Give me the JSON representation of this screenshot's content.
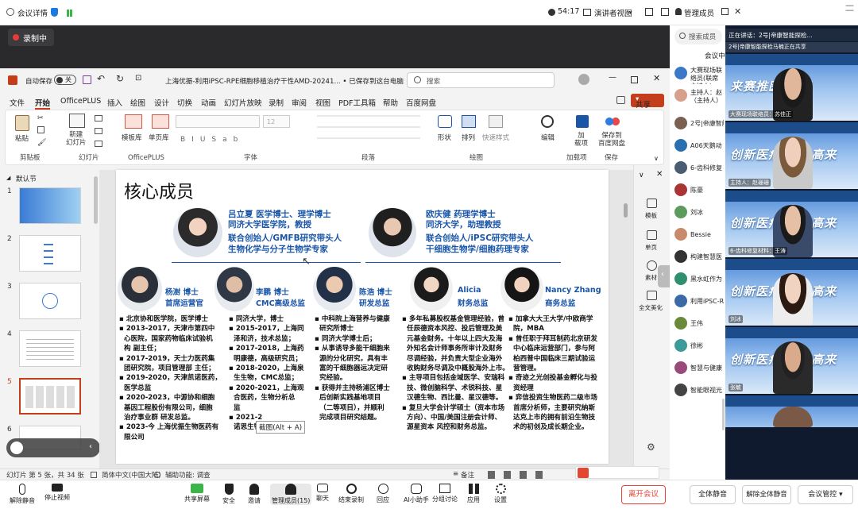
{
  "topbar": {
    "title": "会议详情",
    "time": "54:17",
    "speaker_view": "演讲者视图",
    "manage_members": "管理成员"
  },
  "meeting": {
    "recording": "录制中"
  },
  "ppt": {
    "autosave_label": "自动保存",
    "autosave_state": "关",
    "doc_title": "上海优振-利用iPSC-RPE细胞移植治疗干性AMD-20241... • 已保存到这台电脑",
    "search_placeholder": "搜索",
    "share_label": "共享",
    "menu": [
      "文件",
      "开始",
      "OfficePLUS",
      "插入",
      "绘图",
      "设计",
      "切换",
      "动画",
      "幻灯片放映",
      "录制",
      "审阅",
      "视图",
      "PDF工具箱",
      "帮助",
      "百度网盘"
    ],
    "ribbon": {
      "paste": "粘贴",
      "new_slide": "新建\n幻灯片",
      "template": "模板库",
      "single_page": "单页库",
      "shape": "形状",
      "arrange": "排列",
      "quick_style": "快速样式",
      "edit": "编辑",
      "addin": "加\n载项",
      "save_baidu": "保存到\n百度网盘",
      "font_size": "12",
      "groups": [
        "剪贴板",
        "幻灯片",
        "OfficePLUS",
        "字体",
        "段落",
        "绘图",
        "加载项",
        "保存"
      ]
    },
    "section": "默认节",
    "thumb_numbers": [
      "1",
      "2",
      "3",
      "4",
      "5",
      "6"
    ],
    "side_pane": [
      "模板",
      "单页",
      "素材",
      "全文美化"
    ],
    "tooltip": "截图(Alt + A)",
    "status_left": "幻灯片 第 5 张，共 34 张",
    "status_lang": "简体中文(中国大陆)",
    "status_access": "辅助功能: 调查",
    "status_notes": "备注"
  },
  "slide": {
    "title": "核心成员",
    "p1": {
      "line1": "吕立夏  医学博士、理学博士",
      "line2": "同济大学医学院，教授",
      "line3": "联合创始人/GMFB研究带头人",
      "line4": "生物化学与分子生物学专家"
    },
    "p2": {
      "line1": "欧庆健  药理学博士",
      "line2": "同济大学，助理教授",
      "line3": "联合创始人/iPSC研究带头人",
      "line4": "干细胞生物学/细胞药理专家"
    },
    "m1": {
      "name": "杨澍 博士",
      "role": "首席运营官",
      "text": "▪ 北京协和医学院，医学博士\n▪ 2013-2017，天津市第四中\n  心医院，国家药物临床试验机\n  构 副主任；\n▪ 2017-2019，天士力医药集\n  团研究院，项目管理部 主任；\n▪ 2019-2020，天津凯诺医药，\n  医学总监\n▪ 2020-2023，中源协和细胞\n  基因工程股份有限公司，细胞\n  治疗事业群 研发总监。\n▪ 2023-今 上海优振生物医药有\n  限公司"
    },
    "m2": {
      "name": "李鹏 博士",
      "role": "CMC高级总监",
      "text": "▪ 同济大学，博士\n▪ 2015-2017，上海同\n  泽和济，技术总监；\n▪ 2017-2018，上海药\n  明康德，高级研究员；\n▪ 2018-2020，上海泉\n  生生物，CMC总监；\n▪ 2020-2021，上海观\n  合医药，生物分析总\n  监\n▪ 2021-2\n  诺思生物，副部长。"
    },
    "m3": {
      "name": "陈浩 博士",
      "role": "研发总监",
      "text": "▪ 中科院上海营养与健康\n  研究所博士\n▪ 同济大学博士后；\n▪ 从事诱导多能干细胞来\n  源的分化研究，具有丰\n  富的干细胞器运决定研\n  究经验。\n▪ 获得并主持杨浦区博士\n  后创新实践基地项目\n  （二等项目），并顺利\n  完成项目研究结题。"
    },
    "m4": {
      "name": "Alicia",
      "role": "财务总监",
      "text": "▪ 多年私募股权基金管理经验，曾\n  任辰德资本风控、投后管理及美\n  元基金财务。十年以上四大及海\n  外知名会计师事务所审计及财务\n  尽调经验，并负责大型企业海外\n  收购财务尽调及中概股海外上市。\n▪ 主导项目包括金域医学、安瑞科\n  技、微创脑科学、术锐科技、星\n  汉德生物、西比曼、星汉德等。\n▪ 复旦大学会计学硕士（资本市场\n  方向）、中国/美国注册会计师、\n  源星资本 风控和财务总监。"
    },
    "m5": {
      "name": "Nancy Zhang",
      "role": "商务总监",
      "text": "▪ 加拿大大王大学/中欧商学\n  院，MBA\n▪ 曾任职于拜耳制药北京研发\n  中心临床运营部门，参与阿\n  柏西普中国临床三期试验运\n  营管理。\n▪ 奇迹之光创投基金孵化与投\n  资经理\n▪ 弈信投资生物医药二级市场\n  首席分析师，主要研究纳斯\n  达克上市的拥有前沿生物技\n  术的初创及成长期企业。"
    }
  },
  "members": {
    "search_placeholder": "搜索成员",
    "tab": "会议中",
    "list": [
      "大赛现场联络员(联席主持人)",
      "主持人：赵（主持人）",
      "2号|帝康智能",
      "A06天鹅动",
      "6-齿科修复",
      "陈豪",
      "刘冰",
      "Bessie",
      "构建智慧医",
      "黑水虹作为",
      "利用iPSC-R",
      "王伟",
      "徐彬",
      "智慧与健康",
      "智能眼视光"
    ]
  },
  "videos": {
    "banner_speaking": "正在讲话：2号|帝康智能探检...",
    "banner_share": "2号|帝康智能探检马楠正在共享",
    "slogans": [
      "来赛推医 园蓝",
      "创新医疗 慧聚高来",
      "创新医疗 慧聚高来",
      "创新医疗 慧聚高来",
      "创新医疗 慧聚高来"
    ],
    "names": [
      "大赛现场联络员：苏佳正",
      "主持人：赵珊珊",
      "6-齿科修复材料：王涛",
      "刘冰",
      "张敏"
    ]
  },
  "toolbar": {
    "items": [
      "解除静音",
      "停止视频",
      "共享屏幕",
      "安全",
      "邀请",
      "管理成员(15)",
      "聊天",
      "结束录制",
      "回应",
      "AI小助手",
      "分组讨论",
      "应用",
      "设置"
    ],
    "leave": "离开会议",
    "mute_all": "全体静音",
    "unmute_all": "解除全体静音",
    "meeting_control": "会议管控"
  },
  "colors": {
    "accent": "#1a56a8",
    "leave": "#e5443a",
    "record_dot": "#e83a3a",
    "ppt_orange": "#c43e1c"
  }
}
